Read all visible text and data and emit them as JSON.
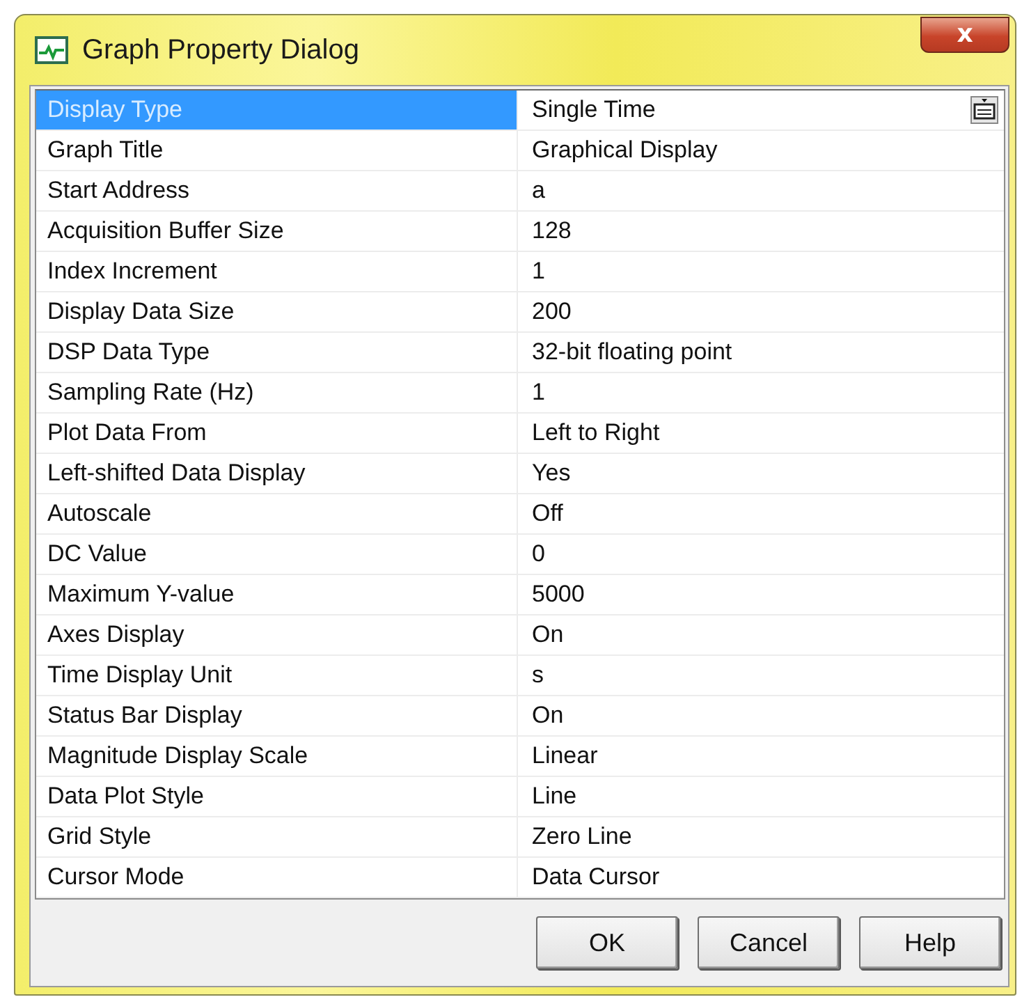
{
  "window": {
    "title": "Graph Property Dialog",
    "close": "x"
  },
  "properties": [
    {
      "name": "Display Type",
      "value": "Single Time",
      "selected": true
    },
    {
      "name": "Graph Title",
      "value": "Graphical Display",
      "selected": false
    },
    {
      "name": "Start Address",
      "value": "a",
      "selected": false
    },
    {
      "name": "Acquisition Buffer Size",
      "value": "128",
      "selected": false
    },
    {
      "name": "Index Increment",
      "value": "1",
      "selected": false
    },
    {
      "name": "Display Data Size",
      "value": "200",
      "selected": false
    },
    {
      "name": "DSP Data Type",
      "value": "32-bit floating point",
      "selected": false
    },
    {
      "name": "Sampling Rate (Hz)",
      "value": "1",
      "selected": false
    },
    {
      "name": "Plot Data From",
      "value": "Left to Right",
      "selected": false
    },
    {
      "name": "Left-shifted Data Display",
      "value": "Yes",
      "selected": false
    },
    {
      "name": "Autoscale",
      "value": "Off",
      "selected": false
    },
    {
      "name": "DC Value",
      "value": "0",
      "selected": false
    },
    {
      "name": "Maximum Y-value",
      "value": "5000",
      "selected": false
    },
    {
      "name": "Axes Display",
      "value": "On",
      "selected": false
    },
    {
      "name": "Time Display Unit",
      "value": "s",
      "selected": false
    },
    {
      "name": "Status Bar Display",
      "value": "On",
      "selected": false
    },
    {
      "name": "Magnitude Display Scale",
      "value": "Linear",
      "selected": false
    },
    {
      "name": "Data Plot Style",
      "value": "Line",
      "selected": false
    },
    {
      "name": "Grid Style",
      "value": "Zero Line",
      "selected": false
    },
    {
      "name": "Cursor Mode",
      "value": "Data Cursor",
      "selected": false
    }
  ],
  "buttons": [
    "OK",
    "Cancel",
    "Help"
  ]
}
